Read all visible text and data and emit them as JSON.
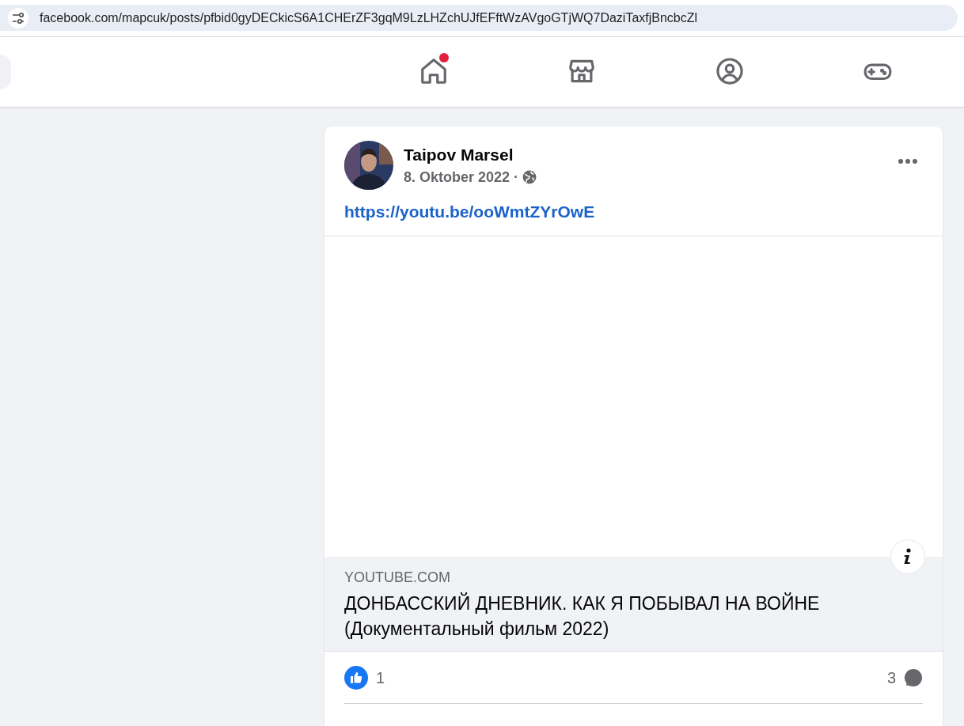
{
  "address_bar": {
    "url": "facebook.com/mapcuk/posts/pfbid0gyDECkicS6A1CHErZF3gqM9LzLHZchUJfEFftWzAVgoGTjWQ7DaziTaxfjBncbcZl"
  },
  "nav": {
    "tabs": [
      {
        "kind": "home",
        "selected": false,
        "notification": true
      },
      {
        "kind": "marketplace",
        "selected": false,
        "notification": false
      },
      {
        "kind": "groups",
        "selected": false,
        "notification": false
      },
      {
        "kind": "gaming",
        "selected": false,
        "notification": false
      }
    ]
  },
  "post": {
    "author": "Taipov Marsel",
    "date": "8. Oktober 2022",
    "separator": "·",
    "link": "https://youtu.be/ooWmtZYrOwE",
    "preview": {
      "source": "YOUTUBE.COM",
      "title": "ДОНБАССКИЙ ДНЕВНИК. КАК Я ПОБЫВАЛ НА ВОЙНЕ (Документальный фильм 2022)"
    },
    "likes": "1",
    "comments": "3"
  }
}
